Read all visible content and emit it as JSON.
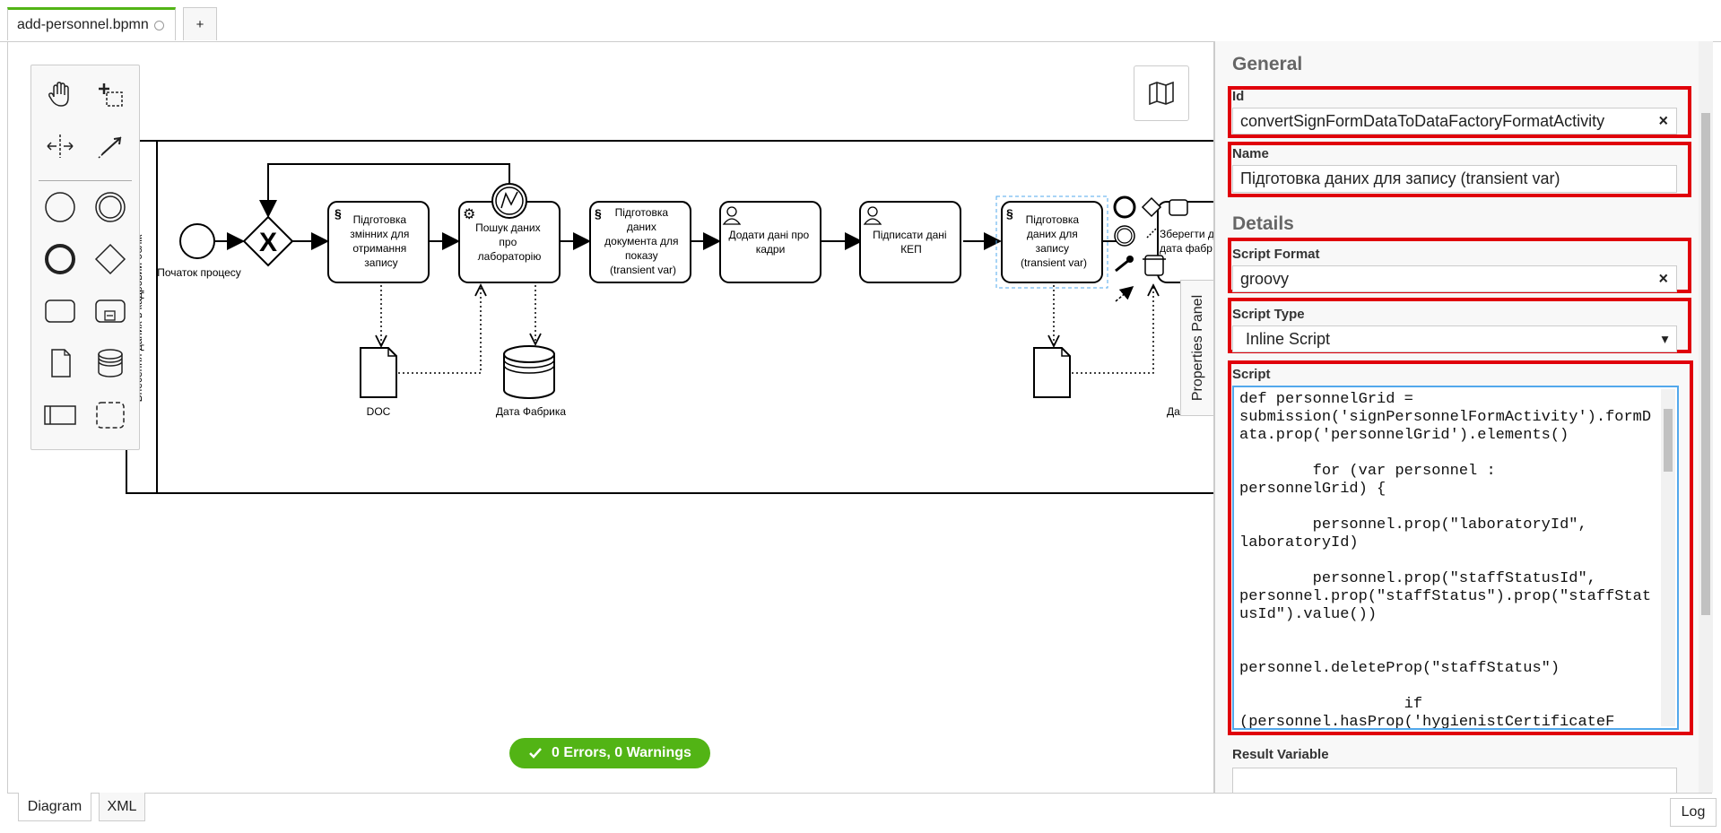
{
  "file_tab": {
    "label": "add-personnel.bpmn",
    "add_label": "+"
  },
  "diagram": {
    "lane_label": "Внесення даних в кадровий облік",
    "start_label": "Початок процесу",
    "tasks": {
      "t1": [
        "Підготовка",
        "змінних для",
        "отримання",
        "запису"
      ],
      "t2": [
        "Пошук даних",
        "про",
        "лабораторію"
      ],
      "t3": [
        "Підготовка",
        "даних",
        "документа для",
        "показу",
        "(transient var)"
      ],
      "t4": [
        "Додати дані про",
        "кадри"
      ],
      "t5": [
        "Підписати дані",
        "КЕП"
      ],
      "t6": [
        "Підготовка",
        "даних для",
        "запису",
        "(transient var)"
      ],
      "t7": [
        "Зберегти д",
        "дата фабр"
      ]
    },
    "doc_label": "DOC",
    "datastore_label": "Дата Фабрика",
    "datastore2_label": "Да"
  },
  "status": {
    "label": "0 Errors, 0 Warnings"
  },
  "bottom_tabs": {
    "diagram": "Diagram",
    "xml": "XML",
    "log": "Log"
  },
  "panel_toggle": {
    "label": "Properties Panel"
  },
  "properties": {
    "general_title": "General",
    "id_label": "Id",
    "id_value": "convertSignFormDataToDataFactoryFormatActivity",
    "name_label": "Name",
    "name_value": "Підготовка даних для запису (transient var)",
    "details_title": "Details",
    "script_format_label": "Script Format",
    "script_format_value": "groovy",
    "script_type_label": "Script Type",
    "script_type_value": "Inline Script",
    "script_label": "Script",
    "script_value": "def personnelGrid =\nsubmission('signPersonnelFormActivity').formData.prop('personnelGrid').elements()\n\n        for (var personnel :\npersonnelGrid) {\n\n        personnel.prop(\"laboratoryId\",\nlaboratoryId)\n\n        personnel.prop(\"staffStatusId\",\npersonnel.prop(\"staffStatus\").prop(\"staffStatusId\").value())\n\n\npersonnel.deleteProp(\"staffStatus\")\n\n                  if\n(personnel.hasProp('hygienistCertificateF",
    "result_variable_label": "Result Variable",
    "clear_symbol": "×",
    "dropdown_symbol": "▾"
  },
  "colors": {
    "accent": "#52b415",
    "highlight": "#e0000b",
    "focus": "#52a8ec"
  }
}
